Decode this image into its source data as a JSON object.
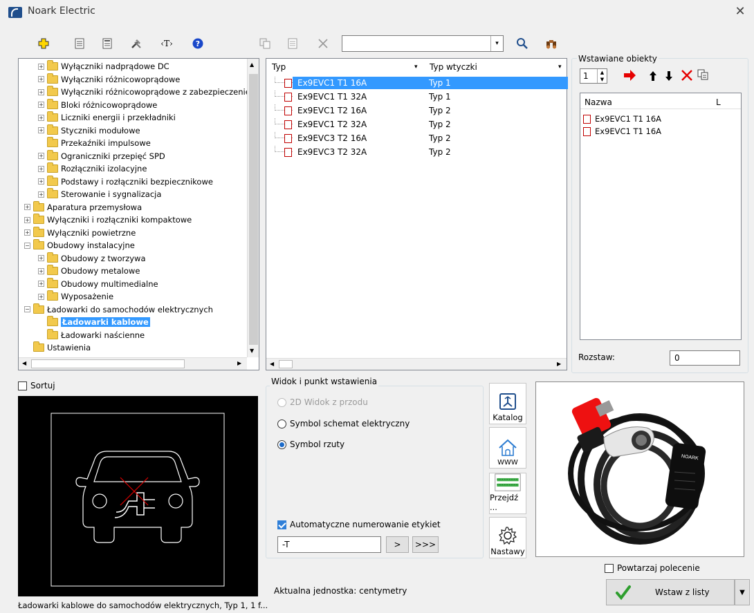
{
  "window": {
    "title": "Noark Electric",
    "close": "✕"
  },
  "toolbar": {
    "search_value": "",
    "search_dropdown": "▾",
    "icons": [
      "add-icon",
      "list-icon",
      "document-icon",
      "tools-icon",
      "text-tag-icon",
      "help-icon",
      "copy-icon",
      "grid-icon",
      "delete-icon",
      "search-icon",
      "binoculars-icon"
    ]
  },
  "tree": {
    "items": [
      {
        "label": "Wyłączniki nadprądowe DC",
        "level": 2,
        "expander": "+"
      },
      {
        "label": "Wyłączniki różnicowoprądowe",
        "level": 2,
        "expander": "+"
      },
      {
        "label": "Wyłączniki różnicowoprądowe z zabezpieczeniem",
        "level": 2,
        "expander": "+"
      },
      {
        "label": "Bloki różnicowoprądowe",
        "level": 2,
        "expander": "+"
      },
      {
        "label": "Liczniki energii i przekładniki",
        "level": 2,
        "expander": "+"
      },
      {
        "label": "Styczniki modułowe",
        "level": 2,
        "expander": "+"
      },
      {
        "label": "Przekaźniki impulsowe",
        "level": 2,
        "expander": ""
      },
      {
        "label": "Ograniczniki przepięć SPD",
        "level": 2,
        "expander": "+"
      },
      {
        "label": "Rozłączniki izolacyjne",
        "level": 2,
        "expander": "+"
      },
      {
        "label": "Podstawy i rozłączniki bezpiecznikowe",
        "level": 2,
        "expander": "+"
      },
      {
        "label": "Sterowanie i sygnalizacja",
        "level": 2,
        "expander": "+"
      },
      {
        "label": "Aparatura przemysłowa",
        "level": 1,
        "expander": "+"
      },
      {
        "label": "Wyłączniki i rozłączniki kompaktowe",
        "level": 1,
        "expander": "+"
      },
      {
        "label": "Wyłączniki powietrzne",
        "level": 1,
        "expander": "+"
      },
      {
        "label": "Obudowy instalacyjne",
        "level": 1,
        "expander": "−"
      },
      {
        "label": "Obudowy z tworzywa",
        "level": 2,
        "expander": "+"
      },
      {
        "label": "Obudowy metalowe",
        "level": 2,
        "expander": "+"
      },
      {
        "label": "Obudowy multimedialne",
        "level": 2,
        "expander": "+"
      },
      {
        "label": "Wyposażenie",
        "level": 2,
        "expander": "+"
      },
      {
        "label": "Ładowarki do samochodów elektrycznych",
        "level": 1,
        "expander": "−"
      },
      {
        "label": "Ładowarki kablowe",
        "level": 2,
        "expander": "",
        "selected": true
      },
      {
        "label": "Ładowarki naścienne",
        "level": 2,
        "expander": ""
      },
      {
        "label": "Ustawienia",
        "level": 1,
        "expander": ""
      }
    ]
  },
  "grid": {
    "col1": "Typ",
    "col2": "Typ wtyczki",
    "rows": [
      {
        "name": "Ex9EVC1 T1 16A",
        "plug": "Typ 1",
        "selected": true
      },
      {
        "name": "Ex9EVC1 T1 32A",
        "plug": "Typ 1"
      },
      {
        "name": "Ex9EVC1 T2 16A",
        "plug": "Typ 2"
      },
      {
        "name": "Ex9EVC1 T2 32A",
        "plug": "Typ 2"
      },
      {
        "name": "Ex9EVC3 T2 16A",
        "plug": "Typ 2"
      },
      {
        "name": "Ex9EVC3 T2 32A",
        "plug": "Typ 2"
      }
    ]
  },
  "inserted": {
    "group_title": "Wstawiane obiekty",
    "quantity": "1",
    "col_name": "Nazwa",
    "col_l": "L",
    "items": [
      "Ex9EVC1 T1 16A",
      "Ex9EVC1 T1 16A"
    ],
    "spacing_label": "Rozstaw:",
    "spacing_value": "0"
  },
  "sort_label": "Sortuj",
  "view": {
    "group_title": "Widok i punkt wstawienia",
    "option_front": "2D Widok z przodu",
    "option_schematic": "Symbol schemat elektryczny",
    "option_plan": "Symbol rzuty",
    "auto_number_label": "Automatyczne numerowanie etykiet",
    "label_value": "-T",
    "btn_next": ">",
    "btn_next_all": ">>>"
  },
  "side_buttons": {
    "catalog": "Katalog",
    "www": "WWW",
    "goto": "Przejdź ...",
    "settings": "Nastawy"
  },
  "repeat_label": "Powtarzaj polecenie",
  "unit_label": "Aktualna jednostka: centymetry",
  "insert_button": "Wstaw z listy",
  "status_text": "Ładowarki kablowe do samochodów elektrycznych, Typ 1, 1 f...",
  "colors": {
    "selection": "#3399ff",
    "accent_red": "#c00000",
    "check_green": "#2e9e2e"
  }
}
